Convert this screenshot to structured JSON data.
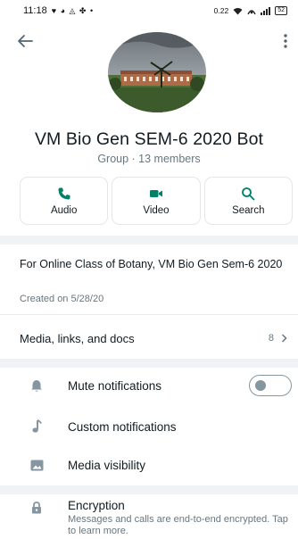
{
  "status_bar": {
    "time": "11:18",
    "notification_icons": "♥ ◕ ◬ ✤ •",
    "data_speed": "0.22",
    "battery": "52"
  },
  "group": {
    "name": "VM Bio Gen SEM-6 2020 Bot",
    "meta": "Group · 13 members"
  },
  "actions": {
    "audio": "Audio",
    "video": "Video",
    "search": "Search"
  },
  "description": {
    "text": "For Online Class of Botany, VM Bio Gen Sem-6 2020",
    "created": "Created on 5/28/20"
  },
  "media": {
    "label": "Media, links, and docs",
    "count": "8"
  },
  "settings": {
    "mute": "Mute notifications",
    "custom": "Custom notifications",
    "visibility": "Media visibility"
  },
  "encryption": {
    "title": "Encryption",
    "subtitle": "Messages and calls are end-to-end encrypted. Tap to learn more."
  },
  "colors": {
    "accent": "#008069",
    "secondary_text": "#667781",
    "icon_gray": "#8696a0"
  }
}
